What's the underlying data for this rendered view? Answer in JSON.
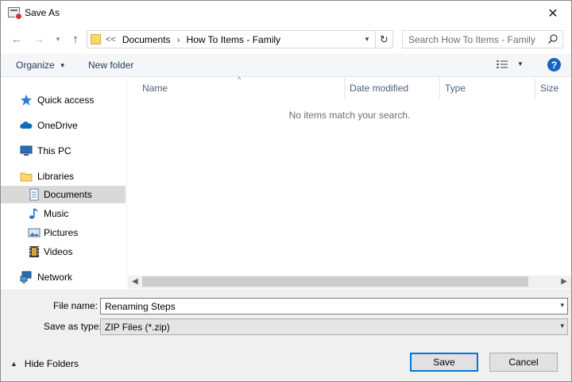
{
  "window": {
    "title": "Save As"
  },
  "nav": {
    "breadcrumb_lead": "<<",
    "breadcrumbs": [
      "Documents",
      "How To Items - Family"
    ],
    "search_placeholder": "Search How To Items - Family"
  },
  "toolbar": {
    "organize_label": "Organize",
    "new_folder_label": "New folder",
    "help_label": "?"
  },
  "sidebar": {
    "items": [
      {
        "label": "Quick access",
        "icon": "star-icon"
      },
      {
        "label": "OneDrive",
        "icon": "cloud-icon"
      },
      {
        "label": "This PC",
        "icon": "computer-icon"
      },
      {
        "label": "Libraries",
        "icon": "library-folder-icon"
      },
      {
        "label": "Documents",
        "icon": "document-icon",
        "selected": true
      },
      {
        "label": "Music",
        "icon": "music-note-icon"
      },
      {
        "label": "Pictures",
        "icon": "picture-icon"
      },
      {
        "label": "Videos",
        "icon": "film-icon"
      },
      {
        "label": "Network",
        "icon": "network-icon"
      }
    ]
  },
  "file_list": {
    "columns": [
      "Name",
      "Date modified",
      "Type",
      "Size"
    ],
    "empty_message": "No items match your search."
  },
  "form": {
    "file_name_label": "File name:",
    "file_name_value": "Renaming Steps",
    "save_as_type_label": "Save as type:",
    "save_as_type_value": "ZIP Files (*.zip)"
  },
  "footer": {
    "hide_folders_label": "Hide Folders",
    "save_label": "Save",
    "cancel_label": "Cancel"
  },
  "colors": {
    "accent": "#0078d7",
    "help_blue": "#1466c1",
    "selected_row": "#d9d9d9",
    "folder_yellow": "#ffd66b"
  }
}
